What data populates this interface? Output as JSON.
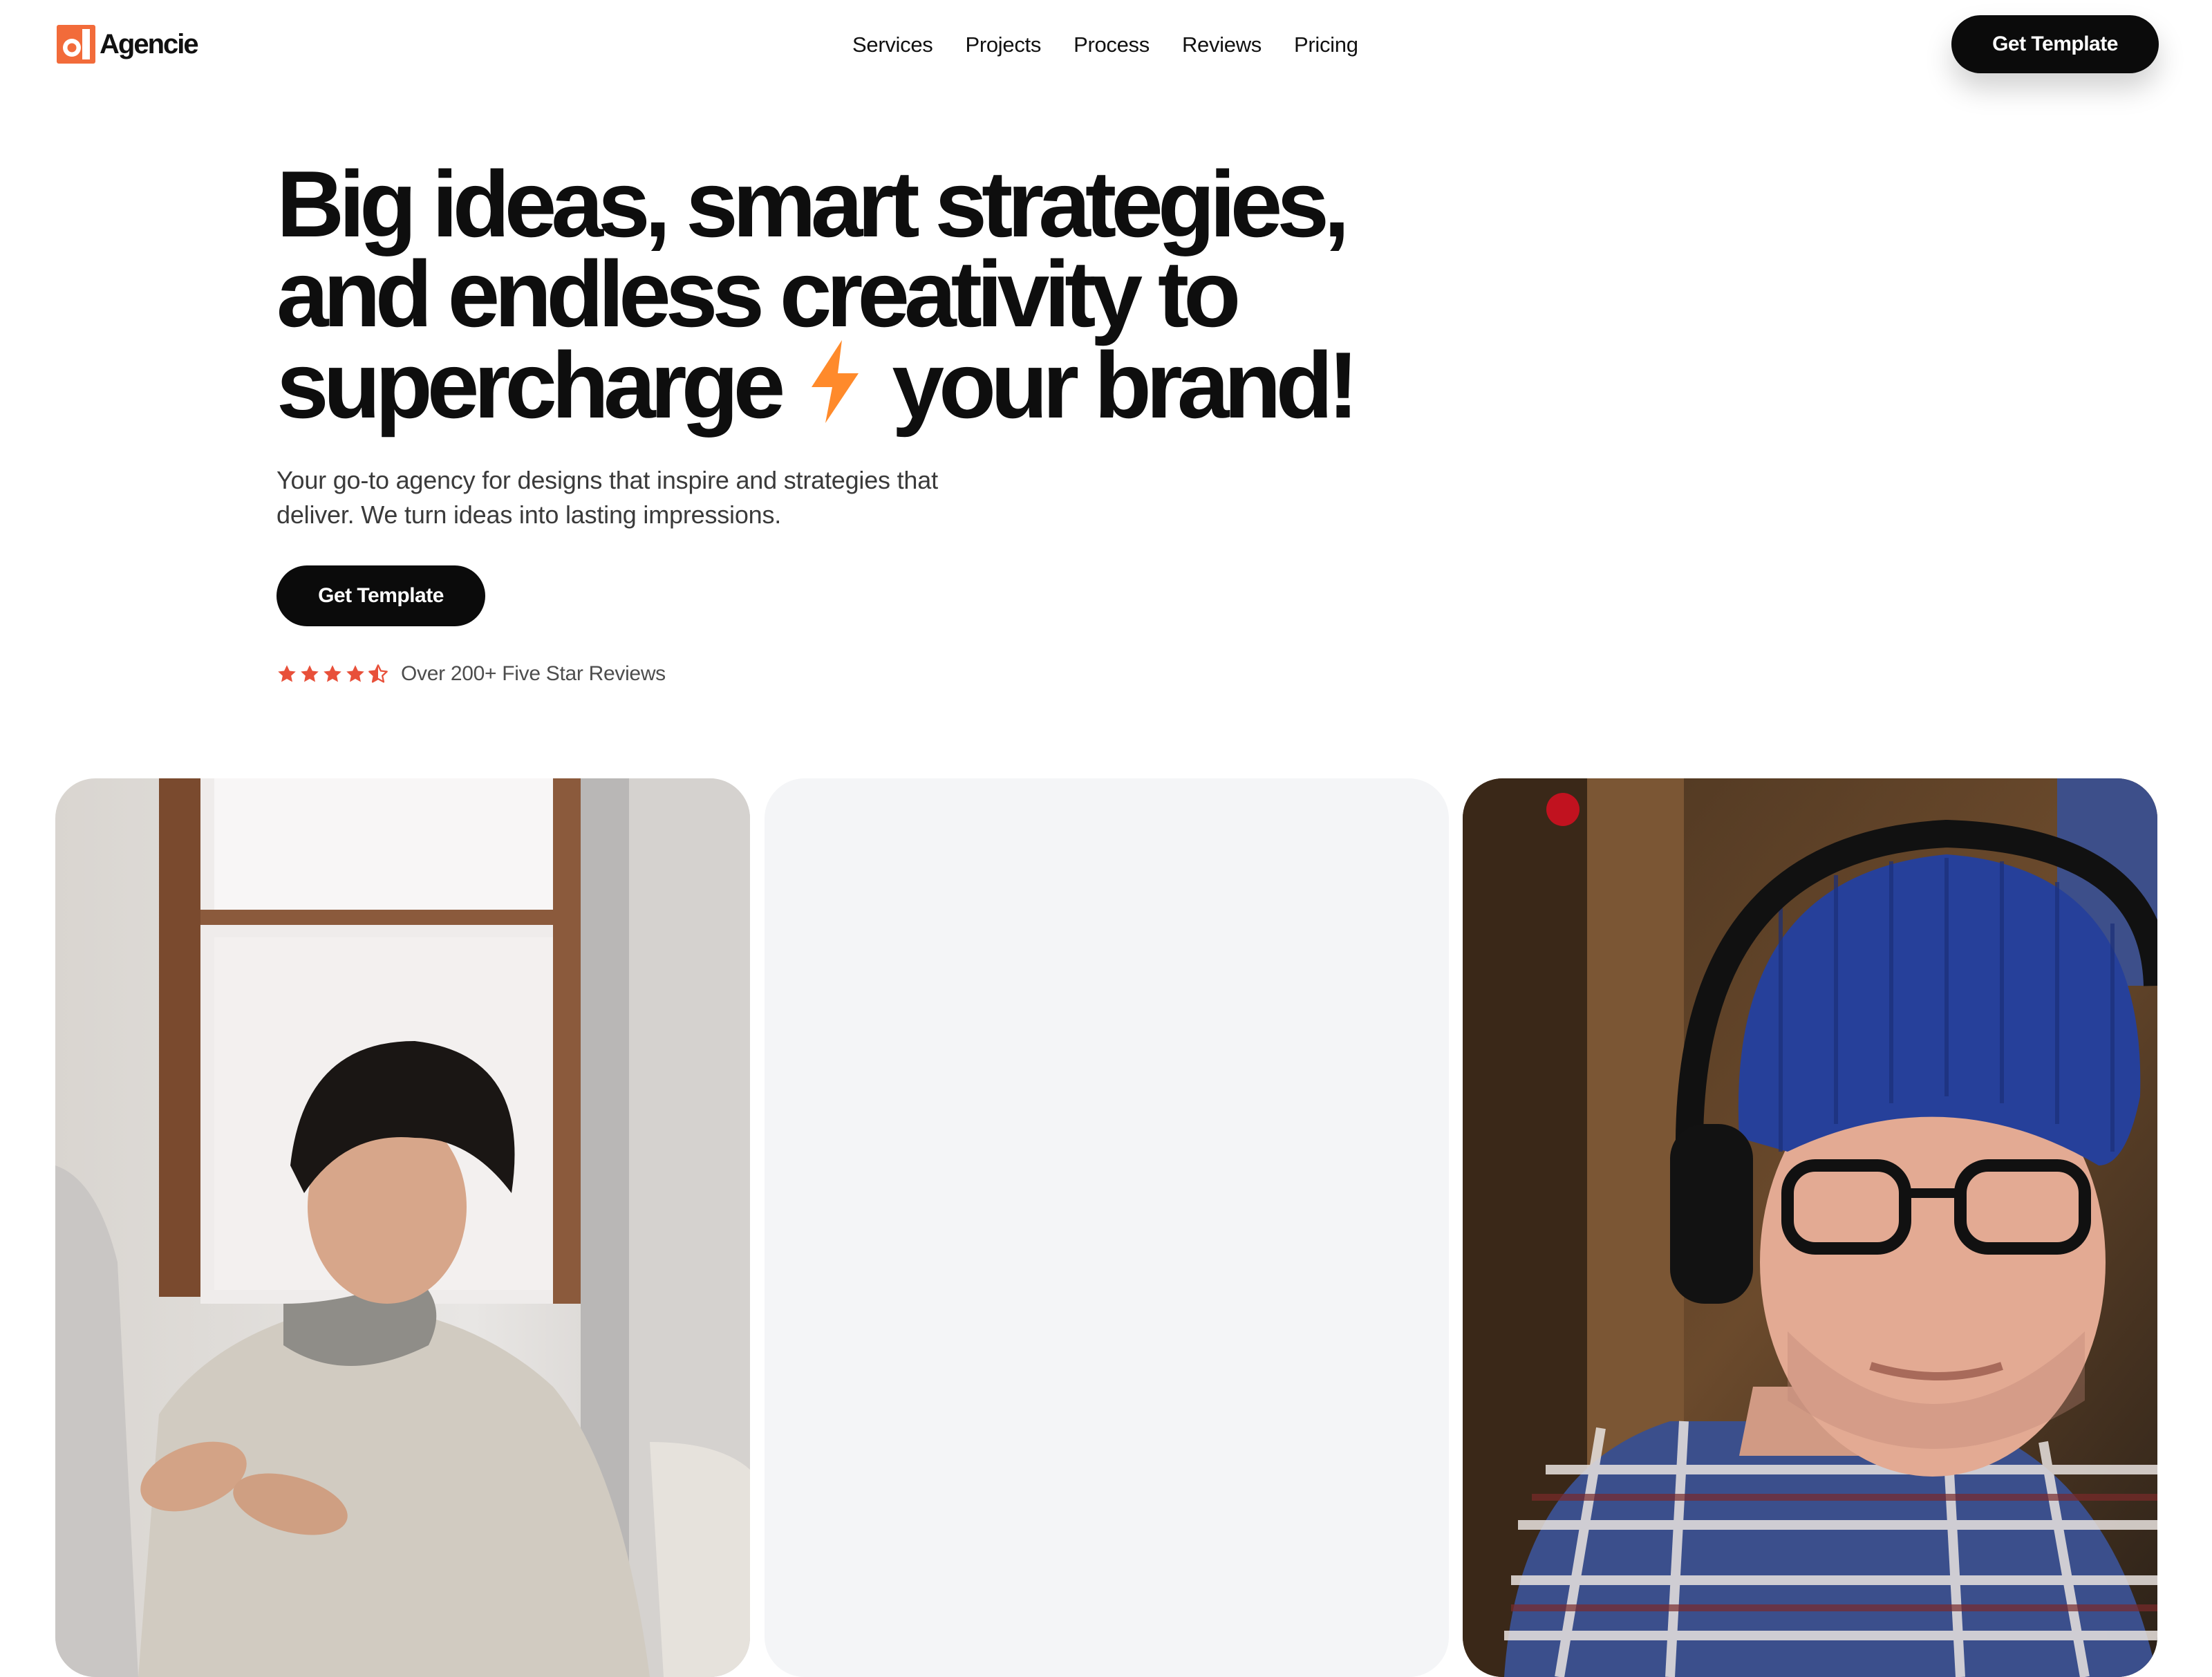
{
  "nav": {
    "brand": "Agencie",
    "links": [
      "Services",
      "Projects",
      "Process",
      "Reviews",
      "Pricing"
    ],
    "cta_label": "Get Template"
  },
  "hero": {
    "headline_line1": "Big ideas, smart strategies,",
    "headline_line2": "and endless creativity to",
    "headline_line3a": "supercharge",
    "headline_line3b": "your brand!",
    "subtext": "Your go-to agency for designs that inspire and strategies that deliver. We turn ideas into lasting impressions.",
    "cta_label": "Get Template",
    "reviews_text": "Over 200+ Five Star Reviews",
    "rating": 4.5,
    "rating_max": 5
  },
  "icons": {
    "logo": "agencie-logo-icon",
    "bolt": "lightning-bolt-icon",
    "star": "star-icon"
  },
  "colors": {
    "accent": "#f26b3a",
    "bolt": "#ff8a2b",
    "star": "#e8503a",
    "dark": "#0b0b0b",
    "card_placeholder": "#f4f5f7"
  },
  "gallery": {
    "cards": [
      "photo-person-hoodie",
      "placeholder",
      "photo-person-headphones"
    ]
  }
}
